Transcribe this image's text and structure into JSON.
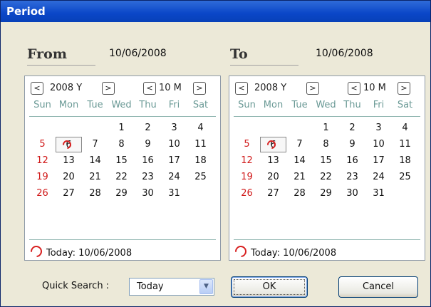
{
  "window": {
    "title": "Period"
  },
  "from": {
    "label": "From",
    "value": "10/06/2008"
  },
  "to": {
    "label": "To",
    "value": "10/06/2008"
  },
  "calendar": {
    "prev_glyph": "<",
    "next_glyph": ">",
    "year_label": "2008 Y",
    "month_label": "10 M",
    "weekdays": [
      "Sun",
      "Mon",
      "Tue",
      "Wed",
      "Thu",
      "Fri",
      "Sat"
    ],
    "weeks": [
      [
        "",
        "",
        "",
        "1",
        "2",
        "3",
        "4"
      ],
      [
        "5",
        "6",
        "7",
        "8",
        "9",
        "10",
        "11"
      ],
      [
        "12",
        "13",
        "14",
        "15",
        "16",
        "17",
        "18"
      ],
      [
        "19",
        "20",
        "21",
        "22",
        "23",
        "24",
        "25"
      ],
      [
        "26",
        "27",
        "28",
        "29",
        "30",
        "31",
        ""
      ]
    ],
    "today_label": "Today:",
    "today_value": "10/06/2008",
    "selected_day": "6"
  },
  "quick_search": {
    "label": "Quick Search :",
    "value": "Today"
  },
  "buttons": {
    "ok": "OK",
    "cancel": "Cancel"
  },
  "colors": {
    "titlebar": "#0a46c8",
    "sunday": "#d01818",
    "weekday_header": "#6b9a96",
    "today_marker": "#d82020"
  }
}
